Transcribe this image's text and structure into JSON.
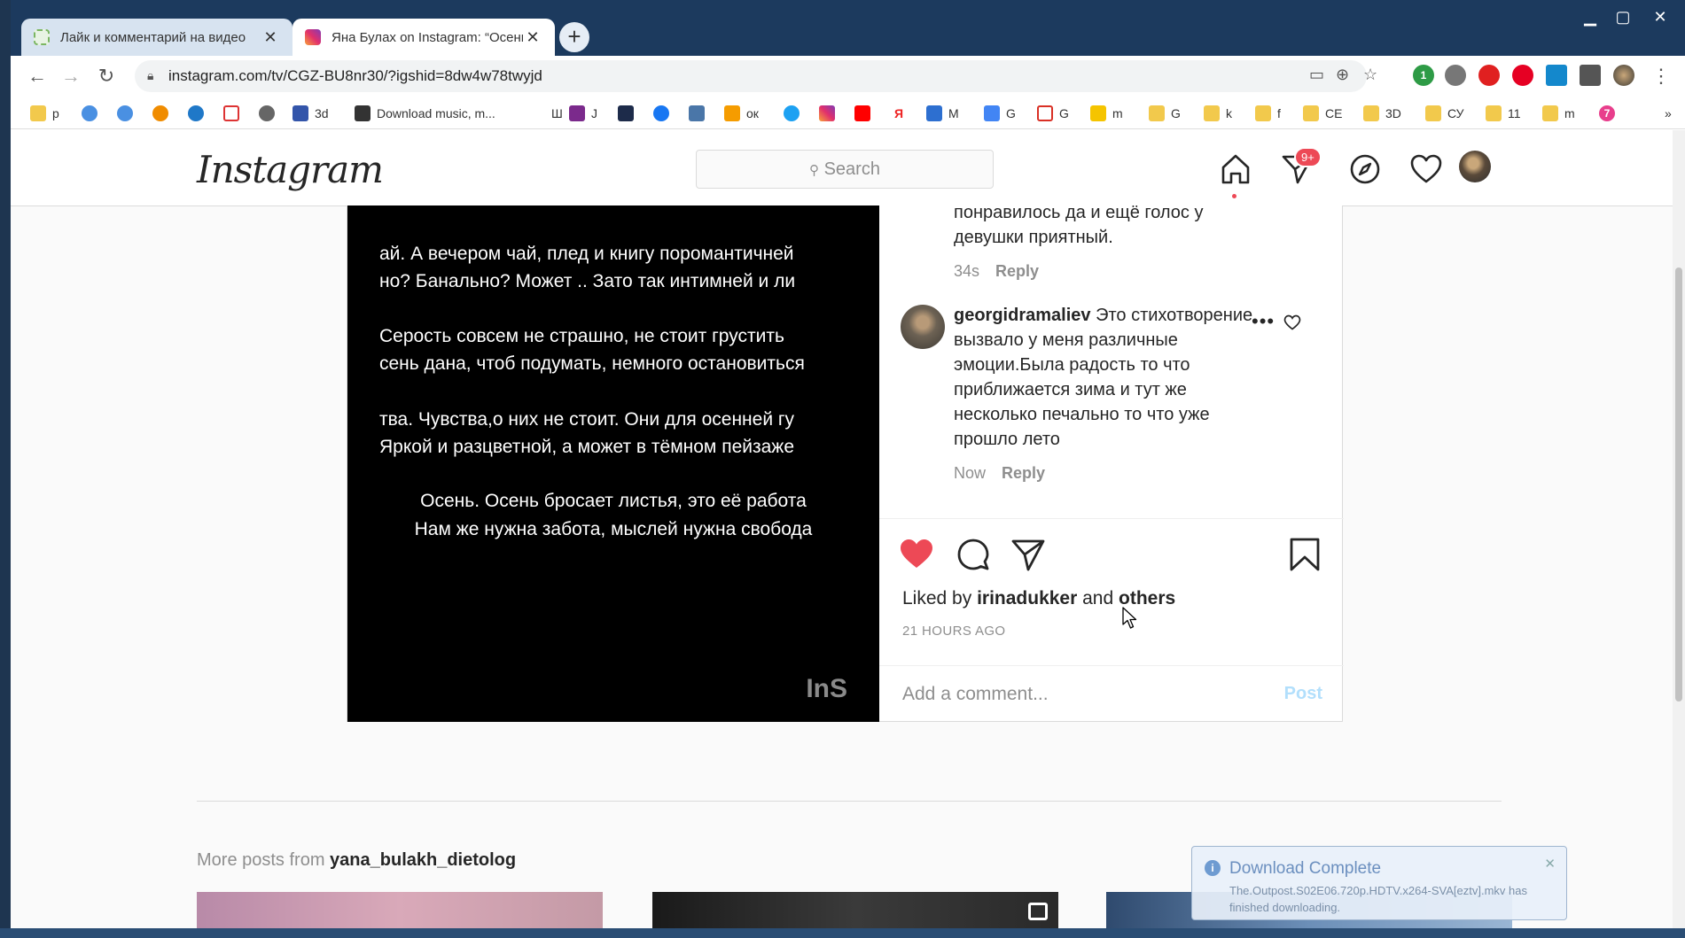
{
  "browser": {
    "tabs": [
      {
        "title": "Лайк и комментарий на видео",
        "active": false
      },
      {
        "title": "Яна Булах on Instagram: “Осень.",
        "active": true
      }
    ],
    "new_tab_label": "+",
    "url": "instagram.com/tv/CGZ-BU8nr30/?igshid=8dw4w78twyjd",
    "extension_badge": "1",
    "bookmarks": [
      "р",
      "",
      "",
      "",
      "",
      "",
      "",
      "3d",
      "Download music, m...",
      "Ш",
      "J",
      "",
      "",
      "",
      "ок",
      "",
      "",
      "",
      "Я",
      "M",
      "G",
      "G",
      "m",
      "G",
      "k",
      "f",
      "CE",
      "3D",
      "СУ",
      "11",
      "m",
      "7"
    ],
    "bookmarks_overflow": "»"
  },
  "instagram": {
    "logo": "Instagram",
    "search_placeholder": "Search",
    "dm_badge": "9+",
    "video_lines": [
      "ай. А вечером чай, плед и книгу поромантичней",
      "но? Банально? Может .. Зато так интимней и ли",
      "Серость совсем не страшно, не стоит грустить",
      "сень дана, чтоб подумать, немного остановиться",
      "тва. Чувства,о них не стоит. Они для осенней гу",
      "Яркой и разцветной, а может в тёмном пейзаже",
      "Осень. Осень бросает листья, это её работа",
      "Нам же нужна забота, мыслей нужна свобода"
    ],
    "video_watermark": "InS",
    "comment1": {
      "text_line1": "понравилось да и ещё голос у",
      "text_line2": "девушки приятный.",
      "time": "34s",
      "reply": "Reply"
    },
    "comment2": {
      "username": "georgidramaliev",
      "text": "Это стихотворение вызвало у меня различные эмоции.Была радость то что приближается зима и тут же несколько печально то что уже прошло лето",
      "time": "Now",
      "reply": "Reply",
      "more": "•••"
    },
    "likes": {
      "prefix": "Liked by",
      "user": "irinadukker",
      "and": "and",
      "others": "others"
    },
    "posted_time": "21 HOURS AGO",
    "comment_placeholder": "Add a comment...",
    "post_button": "Post",
    "more_posts": {
      "prefix": "More posts from",
      "user": "yana_bulakh_dietolog"
    }
  },
  "notification": {
    "title": "Download Complete",
    "message": "The.Outpost.S02E06.720p.HDTV.x264-SVA[eztv].mkv has finished downloading."
  },
  "colors": {
    "like_red": "#ed4956",
    "post_blue": "#b2dffc",
    "tabstrip": "#1c3a5e"
  }
}
